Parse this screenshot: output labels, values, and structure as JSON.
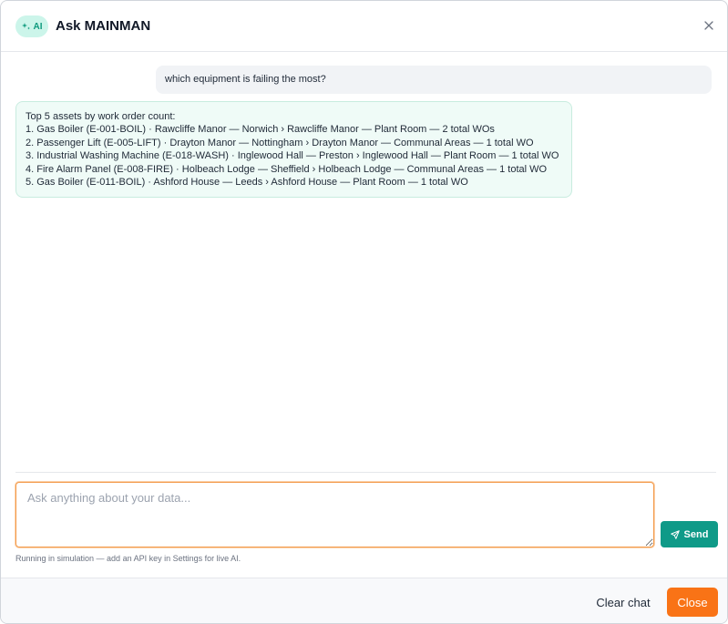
{
  "header": {
    "badge_label": "AI",
    "title": "Ask MAINMAN",
    "close_icon": "close-icon"
  },
  "conversation": {
    "user_message": "which equipment is failing the most?",
    "assistant_message": {
      "intro": "Top 5 assets by work order count:",
      "items": [
        "1. Gas Boiler (E-001-BOIL) · Rawcliffe Manor — Norwich › Rawcliffe Manor — Plant Room — 2 total WOs",
        "2. Passenger Lift (E-005-LIFT) · Drayton Manor — Nottingham › Drayton Manor — Communal Areas — 1 total WO",
        "3. Industrial Washing Machine (E-018-WASH) · Inglewood Hall — Preston › Inglewood Hall — Plant Room — 1 total WO",
        "4. Fire Alarm Panel (E-008-FIRE) · Holbeach Lodge — Sheffield › Holbeach Lodge — Communal Areas — 1 total WO",
        "5. Gas Boiler (E-011-BOIL) · Ashford House — Leeds › Ashford House — Plant Room — 1 total WO"
      ]
    }
  },
  "composer": {
    "placeholder": "Ask anything about your data...",
    "value": "",
    "send_label": "Send",
    "hint": "Running in simulation — add an API key in Settings for live AI."
  },
  "footer": {
    "clear_label": "Clear chat",
    "close_label": "Close"
  },
  "colors": {
    "accent_teal": "#0f9a88",
    "accent_orange": "#f97316",
    "ai_bubble_bg": "#effbf7",
    "user_bubble_bg": "#f1f3f6"
  }
}
